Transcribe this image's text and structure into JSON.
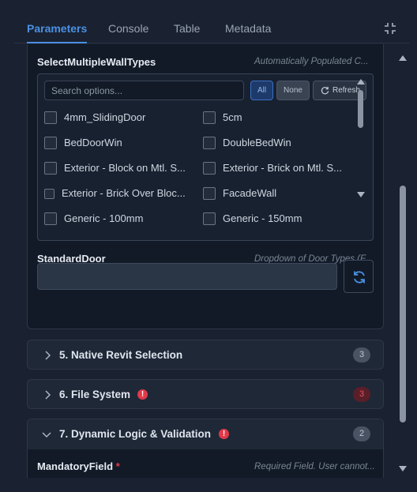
{
  "tabs": [
    {
      "label": "Parameters",
      "active": true
    },
    {
      "label": "Console",
      "active": false
    },
    {
      "label": "Table",
      "active": false
    },
    {
      "label": "Metadata",
      "active": false
    }
  ],
  "collapse_icon": "collapse-icon",
  "wall_types": {
    "label": "SelectMultipleWallTypes",
    "hint": "Automatically Populated C...",
    "search_placeholder": "Search options...",
    "btn_all": "All",
    "btn_none": "None",
    "btn_refresh": "Refresh",
    "options": [
      "4mm_SlidingDoor",
      "5cm",
      "BedDoorWin",
      "DoubleBedWin",
      "Exterior - Block on Mtl. S...",
      "Exterior - Brick on Mtl. S...",
      "Exterior - Brick Over Bloc...",
      "FacadeWall",
      "Generic - 100mm",
      "Generic - 150mm"
    ]
  },
  "standard_door": {
    "label": "StandardDoor",
    "hint": "Dropdown of Door Types (F...",
    "value": ""
  },
  "sections": [
    {
      "title": "5. Native Revit Selection",
      "count": "3",
      "warning": false,
      "expanded": false
    },
    {
      "title": "6. File System",
      "count": "3",
      "warning": true,
      "expanded": false
    },
    {
      "title": "7. Dynamic Logic & Validation",
      "count": "2",
      "warning": true,
      "expanded": true
    }
  ],
  "mandatory": {
    "label": "MandatoryField",
    "star": "*",
    "hint": "Required Field. User cannot..."
  },
  "colors": {
    "accent": "#4a90e2",
    "background": "#1a2130",
    "panel": "#121a27",
    "warning": "#e03a4a"
  }
}
